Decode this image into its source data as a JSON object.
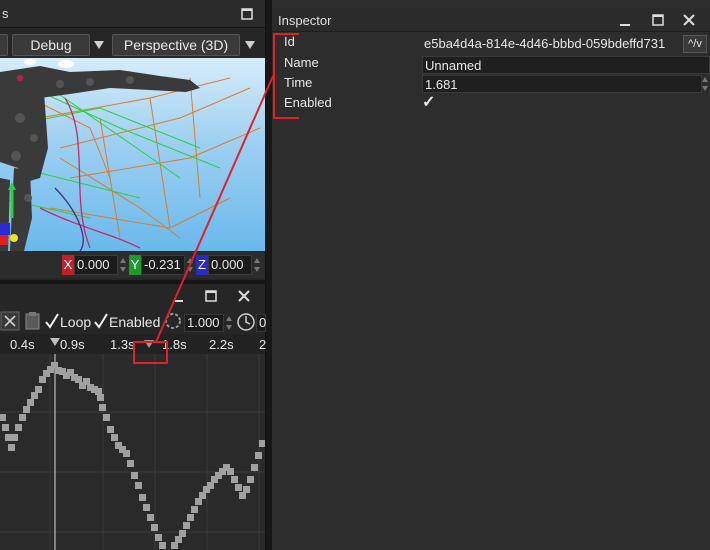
{
  "scene": {
    "title_fragment": "s",
    "mode_dropdown": "Debug",
    "view_dropdown": "Perspective (3D)",
    "coords": {
      "x_tag": "X",
      "x_value": "0.000",
      "y_tag": "Y",
      "y_value": "-0.231",
      "z_tag": "Z",
      "z_value": "0.000"
    }
  },
  "curve": {
    "loop_label": "Loop",
    "enabled_label": "Enabled",
    "speed_value": "1.000",
    "time_fragment": "0",
    "ticks": [
      "0.4s",
      "0.9s",
      "1.3s",
      "1.8s",
      "2.2s",
      "2"
    ]
  },
  "inspector": {
    "title": "Inspector",
    "properties": {
      "id_label": "Id",
      "id_value": "e5ba4d4a-814e-4d46-bbbd-059bdeffd731",
      "id_button": "^/v",
      "name_label": "Name",
      "name_value": "Unnamed",
      "time_label": "Time",
      "time_value": "1.681",
      "enabled_label": "Enabled",
      "enabled_check": "✓"
    }
  },
  "colors": {
    "annotation": "#e0202a",
    "x_axis": "#c0202a",
    "y_axis": "#1e9a2e",
    "z_axis": "#2a2ac8",
    "curve": "#a0a0a0"
  },
  "icons": [
    "maximize-icon",
    "close-icon",
    "minimize-icon",
    "dropdown-arrow-icon",
    "delete-icon",
    "clipboard-icon",
    "speed-dial-icon",
    "clock-icon",
    "checkmark-icon",
    "playhead-marker-icon",
    "keyframe-marker-icon"
  ]
}
